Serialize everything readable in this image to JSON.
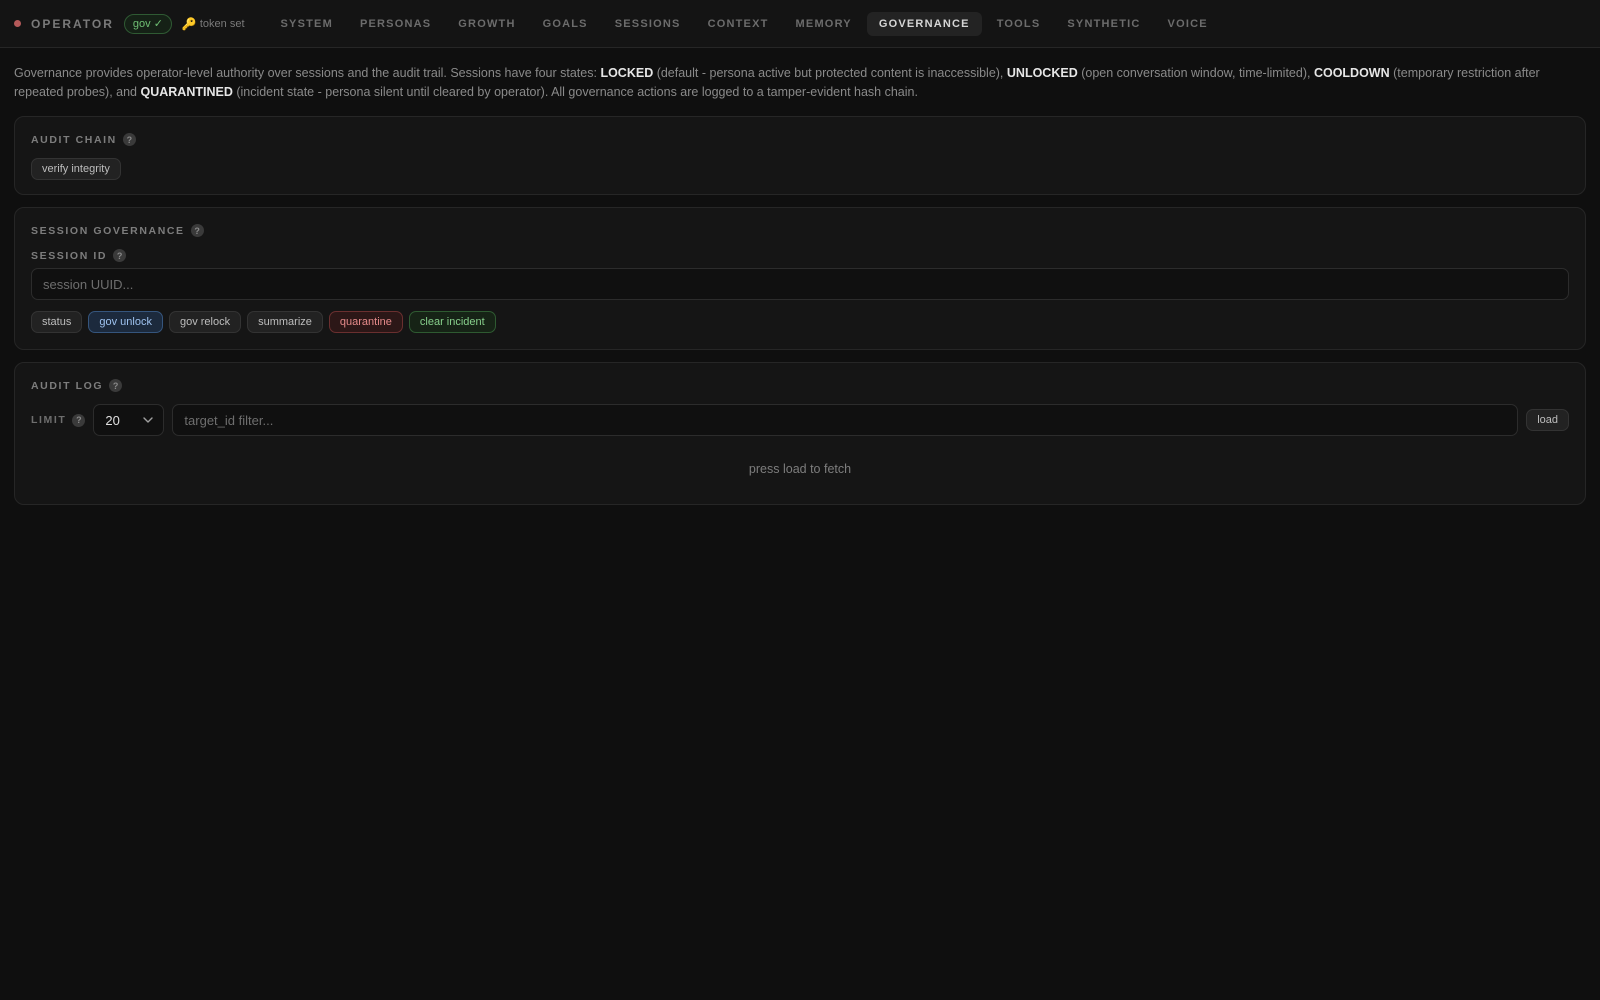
{
  "app": {
    "brand": "OPERATOR",
    "gov_badge": "gov ✓",
    "token_text": "token set",
    "status_color": "#b55a5a"
  },
  "tabs": [
    {
      "label": "SYSTEM",
      "active": false
    },
    {
      "label": "PERSONAS",
      "active": false
    },
    {
      "label": "GROWTH",
      "active": false
    },
    {
      "label": "GOALS",
      "active": false
    },
    {
      "label": "SESSIONS",
      "active": false
    },
    {
      "label": "CONTEXT",
      "active": false
    },
    {
      "label": "MEMORY",
      "active": false
    },
    {
      "label": "GOVERNANCE",
      "active": true
    },
    {
      "label": "TOOLS",
      "active": false
    },
    {
      "label": "SYNTHETIC",
      "active": false
    },
    {
      "label": "VOICE",
      "active": false
    }
  ],
  "intro": {
    "p1": "Governance provides operator-level authority over sessions and the audit trail. Sessions have four states: ",
    "s1": "LOCKED",
    "p2": " (default - persona active but protected content is inaccessible), ",
    "s2": "UNLOCKED",
    "p3": " (open conversation window, time-limited), ",
    "s3": "COOLDOWN",
    "p4": " (temporary restriction after repeated probes), and ",
    "s4": "QUARANTINED",
    "p5": " (incident state - persona silent until cleared by operator). All governance actions are logged to a tamper-evident hash chain."
  },
  "audit_chain": {
    "title": "AUDIT CHAIN",
    "verify_label": "verify integrity"
  },
  "session_governance": {
    "title": "SESSION GOVERNANCE",
    "session_id_label": "SESSION ID",
    "session_id_value": "",
    "session_id_placeholder": "session UUID...",
    "buttons": {
      "status": "status",
      "gov_unlock": "gov unlock",
      "gov_relock": "gov relock",
      "summarize": "summarize",
      "quarantine": "quarantine",
      "clear_incident": "clear incident"
    }
  },
  "audit_log": {
    "title": "AUDIT LOG",
    "limit_label": "LIMIT",
    "limit_value": "20",
    "filter_placeholder": "target_id filter...",
    "load_label": "load",
    "empty_message": "press load to fetch"
  },
  "help_glyph": "?"
}
